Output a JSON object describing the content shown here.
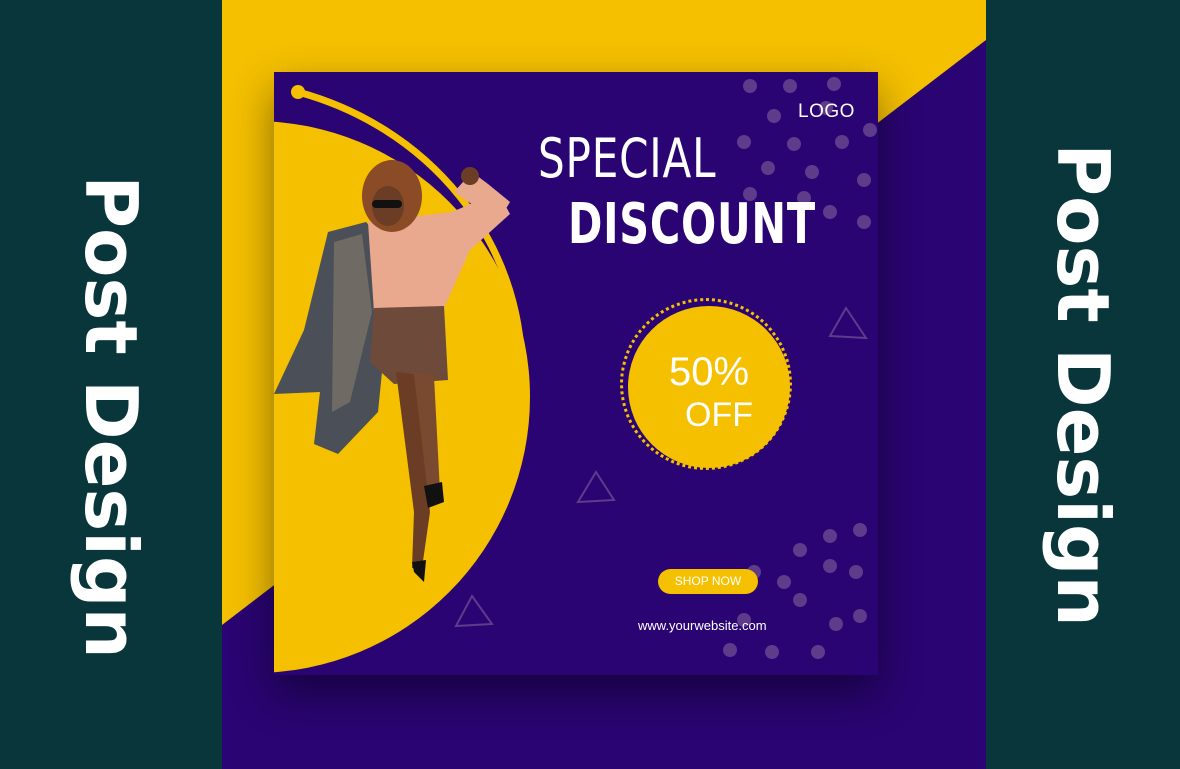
{
  "side_label": "Post Design",
  "post": {
    "logo": "LOGO",
    "title_line1": "SPECIAL",
    "title_line2": "DISCOUNT",
    "discount_value": "50%",
    "discount_suffix": "OFF",
    "cta_label": "SHOP NOW",
    "website": "www.yourwebsite.com",
    "image": "woman-in-sunglasses-and-checked-coat"
  },
  "colors": {
    "side_panel": "#08363a",
    "yellow": "#f5c000",
    "purple": "#2a0472",
    "purple_light": "#3a0a8a",
    "dots": "#5e3b8b"
  }
}
